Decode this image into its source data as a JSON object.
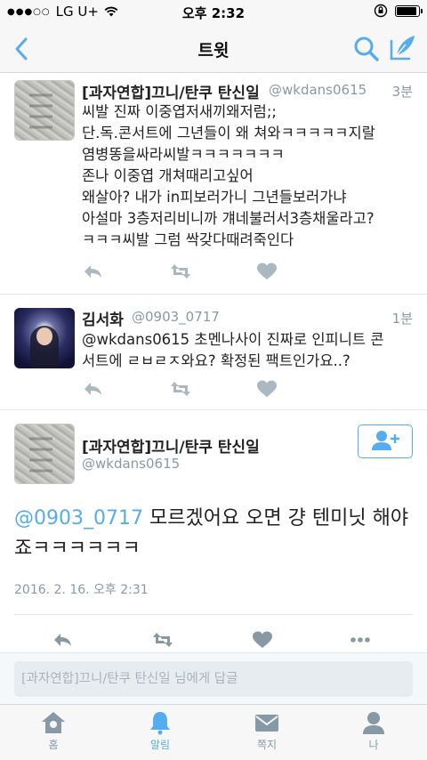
{
  "status_bar": {
    "carrier": "LG U+",
    "time": "오후 2:32"
  },
  "nav": {
    "title": "트윗"
  },
  "tweets": [
    {
      "name": "[과자연합]끄니/탄쿠 탄신일",
      "handle": "@wkdans0615",
      "time": "3분",
      "text": "씨발 진짜 이중엽저새끼왜저럼;;\n단.독.콘서트에 그년들이 왜 쳐와ㅋㅋㅋㅋㅋ지랄\n염병똥을싸라씨발ㅋㅋㅋㅋㅋㅋㅋ\n존나 이중엽 개쳐때리고싶어\n왜살아? 내가 in피보러가니 그년들보러가냐\n아설마 3층저리비니까 걔네불러서3층채울라고?\nㅋㅋㅋ씨발 그럼 싹갖다때려죽인다"
    },
    {
      "name": "김서화",
      "handle": "@0903_0717",
      "time": "1분",
      "text": "@wkdans0615 초멘나사이 진짜로 인피니트 콘\n서트에 ㄹㅂㄹㅈ와요? 확정된 팩트인가요..?"
    }
  ],
  "detail": {
    "name": "[과자연합]끄니/탄쿠 탄신일",
    "handle": "@wkdans0615",
    "mention": "@0903_0717",
    "text": " 모르겠어요 오면 걍 텐미닛 해야죠ㅋㅋㅋㅋㅋㅋ",
    "timestamp": "2016. 2. 16. 오후 2:31"
  },
  "reply": {
    "placeholder": "[과자연합]끄니/탄쿠 탄신일 님에게 답글"
  },
  "tabs": [
    {
      "label": "홈",
      "icon": "home-icon"
    },
    {
      "label": "알림",
      "icon": "bell-icon"
    },
    {
      "label": "쪽지",
      "icon": "envelope-icon"
    },
    {
      "label": "나",
      "icon": "person-icon"
    }
  ],
  "colors": {
    "accent": "#55acee",
    "gray": "#8899a6",
    "action_gray": "#aab8c2"
  }
}
